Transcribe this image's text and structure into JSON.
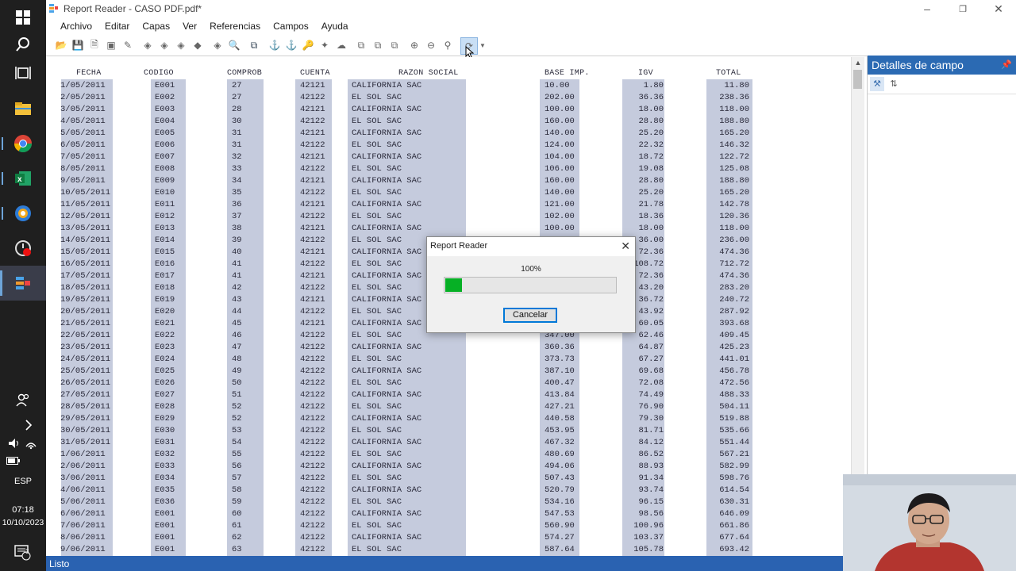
{
  "window": {
    "title": "Report Reader - CASO PDF.pdf*"
  },
  "menu": [
    "Archivo",
    "Editar",
    "Capas",
    "Ver",
    "Referencias",
    "Campos",
    "Ayuda"
  ],
  "report": {
    "headers": [
      "FECHA",
      "CODIGO",
      "COMPROB",
      "CUENTA",
      "RAZON SOCIAL",
      "BASE IMP.",
      "IGV",
      "TOTAL"
    ],
    "rows": [
      [
        "1/05/2011",
        "E001",
        "27",
        "42121",
        "CALIFORNIA SAC",
        "10.00",
        "1.80",
        "11.80"
      ],
      [
        "2/05/2011",
        "E002",
        "27",
        "42122",
        "EL SOL SAC",
        "202.00",
        "36.36",
        "238.36"
      ],
      [
        "3/05/2011",
        "E003",
        "28",
        "42121",
        "CALIFORNIA SAC",
        "100.00",
        "18.00",
        "118.00"
      ],
      [
        "4/05/2011",
        "E004",
        "30",
        "42122",
        "EL SOL SAC",
        "160.00",
        "28.80",
        "188.80"
      ],
      [
        "5/05/2011",
        "E005",
        "31",
        "42121",
        "CALIFORNIA SAC",
        "140.00",
        "25.20",
        "165.20"
      ],
      [
        "6/05/2011",
        "E006",
        "31",
        "42122",
        "EL SOL SAC",
        "124.00",
        "22.32",
        "146.32"
      ],
      [
        "7/05/2011",
        "E007",
        "32",
        "42121",
        "CALIFORNIA SAC",
        "104.00",
        "18.72",
        "122.72"
      ],
      [
        "8/05/2011",
        "E008",
        "33",
        "42122",
        "EL SOL SAC",
        "106.00",
        "19.08",
        "125.08"
      ],
      [
        "9/05/2011",
        "E009",
        "34",
        "42121",
        "CALIFORNIA SAC",
        "160.00",
        "28.80",
        "188.80"
      ],
      [
        "10/05/2011",
        "E010",
        "35",
        "42122",
        "EL SOL SAC",
        "140.00",
        "25.20",
        "165.20"
      ],
      [
        "11/05/2011",
        "E011",
        "36",
        "42121",
        "CALIFORNIA SAC",
        "121.00",
        "21.78",
        "142.78"
      ],
      [
        "12/05/2011",
        "E012",
        "37",
        "42122",
        "EL SOL SAC",
        "102.00",
        "18.36",
        "120.36"
      ],
      [
        "13/05/2011",
        "E013",
        "38",
        "42121",
        "CALIFORNIA SAC",
        "100.00",
        "18.00",
        "118.00"
      ],
      [
        "14/05/2011",
        "E014",
        "39",
        "42122",
        "EL SOL SAC",
        "",
        "36.00",
        "236.00"
      ],
      [
        "15/05/2011",
        "E015",
        "40",
        "42121",
        "CALIFORNIA SAC",
        "",
        "72.36",
        "474.36"
      ],
      [
        "16/05/2011",
        "E016",
        "41",
        "42122",
        "EL SOL SAC",
        "",
        "108.72",
        "712.72"
      ],
      [
        "17/05/2011",
        "E017",
        "41",
        "42121",
        "CALIFORNIA SAC",
        "",
        "72.36",
        "474.36"
      ],
      [
        "18/05/2011",
        "E018",
        "42",
        "42122",
        "EL SOL SAC",
        "",
        "43.20",
        "283.20"
      ],
      [
        "19/05/2011",
        "E019",
        "43",
        "42121",
        "CALIFORNIA SAC",
        "",
        "36.72",
        "240.72"
      ],
      [
        "20/05/2011",
        "E020",
        "44",
        "42122",
        "EL SOL SAC",
        "",
        "43.92",
        "287.92"
      ],
      [
        "21/05/2011",
        "E021",
        "45",
        "42121",
        "CALIFORNIA SAC",
        "",
        "60.05",
        "393.68"
      ],
      [
        "22/05/2011",
        "E022",
        "46",
        "42122",
        "EL SOL SAC",
        "347.00",
        "62.46",
        "409.45"
      ],
      [
        "23/05/2011",
        "E023",
        "47",
        "42122",
        "CALIFORNIA SAC",
        "360.36",
        "64.87",
        "425.23"
      ],
      [
        "24/05/2011",
        "E024",
        "48",
        "42122",
        "EL SOL SAC",
        "373.73",
        "67.27",
        "441.01"
      ],
      [
        "25/05/2011",
        "E025",
        "49",
        "42122",
        "CALIFORNIA SAC",
        "387.10",
        "69.68",
        "456.78"
      ],
      [
        "26/05/2011",
        "E026",
        "50",
        "42122",
        "EL SOL SAC",
        "400.47",
        "72.08",
        "472.56"
      ],
      [
        "27/05/2011",
        "E027",
        "51",
        "42122",
        "CALIFORNIA SAC",
        "413.84",
        "74.49",
        "488.33"
      ],
      [
        "28/05/2011",
        "E028",
        "52",
        "42122",
        "EL SOL SAC",
        "427.21",
        "76.90",
        "504.11"
      ],
      [
        "29/05/2011",
        "E029",
        "52",
        "42122",
        "CALIFORNIA SAC",
        "440.58",
        "79.30",
        "519.88"
      ],
      [
        "30/05/2011",
        "E030",
        "53",
        "42122",
        "EL SOL SAC",
        "453.95",
        "81.71",
        "535.66"
      ],
      [
        "31/05/2011",
        "E031",
        "54",
        "42122",
        "CALIFORNIA SAC",
        "467.32",
        "84.12",
        "551.44"
      ],
      [
        "1/06/2011",
        "E032",
        "55",
        "42122",
        "EL SOL SAC",
        "480.69",
        "86.52",
        "567.21"
      ],
      [
        "2/06/2011",
        "E033",
        "56",
        "42122",
        "CALIFORNIA SAC",
        "494.06",
        "88.93",
        "582.99"
      ],
      [
        "3/06/2011",
        "E034",
        "57",
        "42122",
        "EL SOL SAC",
        "507.43",
        "91.34",
        "598.76"
      ],
      [
        "4/06/2011",
        "E035",
        "58",
        "42122",
        "CALIFORNIA SAC",
        "520.79",
        "93.74",
        "614.54"
      ],
      [
        "5/06/2011",
        "E036",
        "59",
        "42122",
        "EL SOL SAC",
        "534.16",
        "96.15",
        "630.31"
      ],
      [
        "6/06/2011",
        "E001",
        "60",
        "42122",
        "CALIFORNIA SAC",
        "547.53",
        "98.56",
        "646.09"
      ],
      [
        "7/06/2011",
        "E001",
        "61",
        "42122",
        "EL SOL SAC",
        "560.90",
        "100.96",
        "661.86"
      ],
      [
        "8/06/2011",
        "E001",
        "62",
        "42122",
        "CALIFORNIA SAC",
        "574.27",
        "103.37",
        "677.64"
      ],
      [
        "9/06/2011",
        "E001",
        "63",
        "42122",
        "EL SOL SAC",
        "587.64",
        "105.78",
        "693.42"
      ]
    ]
  },
  "panel": {
    "title": "Detalles de campo"
  },
  "status": {
    "text": "Listo"
  },
  "dialog": {
    "title": "Report Reader",
    "percent": "100%",
    "progress": 0.1,
    "cancel_label": "Cancelar"
  },
  "taskbar": {
    "lang": "ESP",
    "time": "07:18",
    "date": "10/10/2023",
    "notif_count": "3"
  },
  "colors": {
    "accent": "#2b6ab3",
    "status_bar": "#2a62b1",
    "column_fill": "#c5cbdd",
    "progress": "#06b025"
  }
}
